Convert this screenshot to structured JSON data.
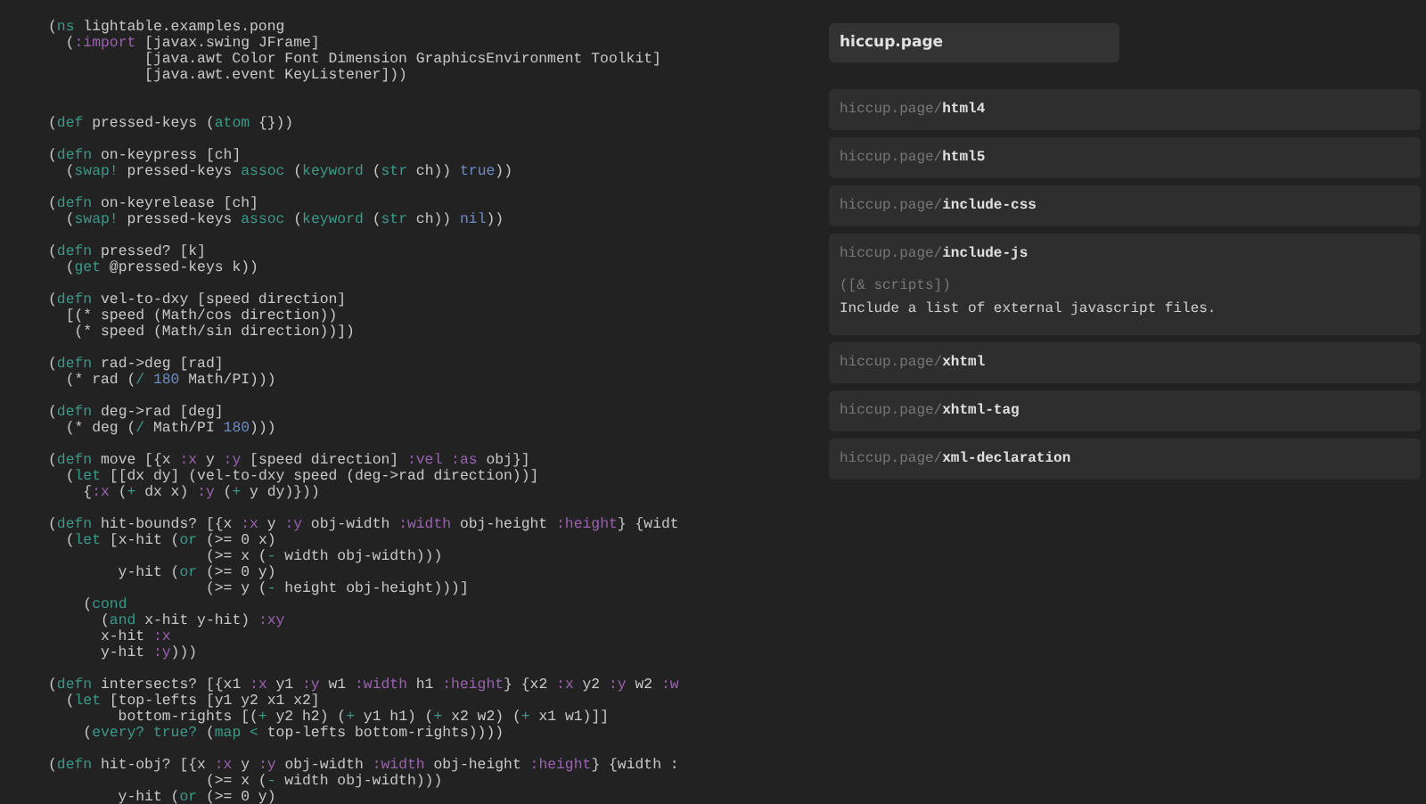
{
  "editor": {
    "lines": [
      {
        "kind": "code",
        "tokens": [
          {
            "kind": "text",
            "text": "("
          },
          {
            "kind": "core",
            "text": "ns"
          },
          {
            "kind": "text",
            "text": " lightable.examples.pong"
          }
        ]
      },
      {
        "kind": "code",
        "tokens": [
          {
            "kind": "text",
            "text": "  ("
          },
          {
            "kind": "keyword",
            "text": ":import"
          },
          {
            "kind": "text",
            "text": " [javax.swing JFrame]"
          }
        ]
      },
      {
        "kind": "code",
        "tokens": [
          {
            "kind": "text",
            "text": "           [java.awt Color Font Dimension GraphicsEnvironment Toolkit]"
          }
        ]
      },
      {
        "kind": "code",
        "tokens": [
          {
            "kind": "text",
            "text": "           [java.awt.event KeyListener]))"
          }
        ]
      },
      {
        "kind": "blank"
      },
      {
        "kind": "blank"
      },
      {
        "kind": "code",
        "tokens": [
          {
            "kind": "text",
            "text": "("
          },
          {
            "kind": "core",
            "text": "def"
          },
          {
            "kind": "text",
            "text": " pressed-keys ("
          },
          {
            "kind": "core",
            "text": "atom"
          },
          {
            "kind": "text",
            "text": " {}))"
          }
        ]
      },
      {
        "kind": "blank"
      },
      {
        "kind": "code",
        "tokens": [
          {
            "kind": "text",
            "text": "("
          },
          {
            "kind": "core",
            "text": "defn"
          },
          {
            "kind": "text",
            "text": " on-keypress [ch]"
          }
        ]
      },
      {
        "kind": "code",
        "tokens": [
          {
            "kind": "text",
            "text": "  ("
          },
          {
            "kind": "core",
            "text": "swap!"
          },
          {
            "kind": "text",
            "text": " pressed-keys "
          },
          {
            "kind": "core",
            "text": "assoc"
          },
          {
            "kind": "text",
            "text": " ("
          },
          {
            "kind": "core",
            "text": "keyword"
          },
          {
            "kind": "text",
            "text": " ("
          },
          {
            "kind": "core",
            "text": "str"
          },
          {
            "kind": "text",
            "text": " ch)) "
          },
          {
            "kind": "literal",
            "text": "true"
          },
          {
            "kind": "text",
            "text": "))"
          }
        ]
      },
      {
        "kind": "blank"
      },
      {
        "kind": "code",
        "tokens": [
          {
            "kind": "text",
            "text": "("
          },
          {
            "kind": "core",
            "text": "defn"
          },
          {
            "kind": "text",
            "text": " on-keyrelease [ch]"
          }
        ]
      },
      {
        "kind": "code",
        "tokens": [
          {
            "kind": "text",
            "text": "  ("
          },
          {
            "kind": "core",
            "text": "swap!"
          },
          {
            "kind": "text",
            "text": " pressed-keys "
          },
          {
            "kind": "core",
            "text": "assoc"
          },
          {
            "kind": "text",
            "text": " ("
          },
          {
            "kind": "core",
            "text": "keyword"
          },
          {
            "kind": "text",
            "text": " ("
          },
          {
            "kind": "core",
            "text": "str"
          },
          {
            "kind": "text",
            "text": " ch)) "
          },
          {
            "kind": "literal",
            "text": "nil"
          },
          {
            "kind": "text",
            "text": "))"
          }
        ]
      },
      {
        "kind": "blank"
      },
      {
        "kind": "code",
        "tokens": [
          {
            "kind": "text",
            "text": "("
          },
          {
            "kind": "core",
            "text": "defn"
          },
          {
            "kind": "text",
            "text": " pressed? [k]"
          }
        ]
      },
      {
        "kind": "code",
        "tokens": [
          {
            "kind": "text",
            "text": "  ("
          },
          {
            "kind": "core",
            "text": "get"
          },
          {
            "kind": "text",
            "text": " @pressed-keys k))"
          }
        ]
      },
      {
        "kind": "blank"
      },
      {
        "kind": "code",
        "tokens": [
          {
            "kind": "text",
            "text": "("
          },
          {
            "kind": "core",
            "text": "defn"
          },
          {
            "kind": "text",
            "text": " vel-to-dxy [speed direction]"
          }
        ]
      },
      {
        "kind": "code",
        "tokens": [
          {
            "kind": "text",
            "text": "  [(* speed (Math/cos direction))"
          }
        ]
      },
      {
        "kind": "code",
        "tokens": [
          {
            "kind": "text",
            "text": "   (* speed (Math/sin direction))])"
          }
        ]
      },
      {
        "kind": "blank"
      },
      {
        "kind": "code",
        "tokens": [
          {
            "kind": "text",
            "text": "("
          },
          {
            "kind": "core",
            "text": "defn"
          },
          {
            "kind": "text",
            "text": " rad->deg [rad]"
          }
        ]
      },
      {
        "kind": "code",
        "tokens": [
          {
            "kind": "text",
            "text": "  (* rad ("
          },
          {
            "kind": "core",
            "text": "/"
          },
          {
            "kind": "literal",
            "text": " 180"
          },
          {
            "kind": "text",
            "text": " Math/PI)))"
          }
        ]
      },
      {
        "kind": "blank"
      },
      {
        "kind": "code",
        "tokens": [
          {
            "kind": "text",
            "text": "("
          },
          {
            "kind": "core",
            "text": "defn"
          },
          {
            "kind": "text",
            "text": " deg->rad [deg]"
          }
        ]
      },
      {
        "kind": "code",
        "tokens": [
          {
            "kind": "text",
            "text": "  (* deg ("
          },
          {
            "kind": "core",
            "text": "/"
          },
          {
            "kind": "text",
            "text": " Math/PI "
          },
          {
            "kind": "literal",
            "text": "180"
          },
          {
            "kind": "text",
            "text": ")))"
          }
        ]
      },
      {
        "kind": "blank"
      },
      {
        "kind": "code",
        "tokens": [
          {
            "kind": "text",
            "text": "("
          },
          {
            "kind": "core",
            "text": "defn"
          },
          {
            "kind": "text",
            "text": " move [{x "
          },
          {
            "kind": "keyword",
            "text": ":x"
          },
          {
            "kind": "text",
            "text": " y "
          },
          {
            "kind": "keyword",
            "text": ":y"
          },
          {
            "kind": "text",
            "text": " [speed direction] "
          },
          {
            "kind": "keyword",
            "text": ":vel :as"
          },
          {
            "kind": "text",
            "text": " obj}]"
          }
        ]
      },
      {
        "kind": "code",
        "tokens": [
          {
            "kind": "text",
            "text": "  ("
          },
          {
            "kind": "core",
            "text": "let"
          },
          {
            "kind": "text",
            "text": " [[dx dy] (vel-to-dxy speed (deg->rad direction))]"
          }
        ]
      },
      {
        "kind": "code",
        "tokens": [
          {
            "kind": "text",
            "text": "    {"
          },
          {
            "kind": "keyword",
            "text": ":x"
          },
          {
            "kind": "text",
            "text": " ("
          },
          {
            "kind": "core",
            "text": "+"
          },
          {
            "kind": "text",
            "text": " dx x) "
          },
          {
            "kind": "keyword",
            "text": ":y"
          },
          {
            "kind": "text",
            "text": " ("
          },
          {
            "kind": "core",
            "text": "+"
          },
          {
            "kind": "text",
            "text": " y dy)}))"
          }
        ]
      },
      {
        "kind": "blank"
      },
      {
        "kind": "code",
        "tokens": [
          {
            "kind": "text",
            "text": "("
          },
          {
            "kind": "core",
            "text": "defn"
          },
          {
            "kind": "text",
            "text": " hit-bounds? [{x "
          },
          {
            "kind": "keyword",
            "text": ":x"
          },
          {
            "kind": "text",
            "text": " y "
          },
          {
            "kind": "keyword",
            "text": ":y"
          },
          {
            "kind": "text",
            "text": " obj-width "
          },
          {
            "kind": "keyword",
            "text": ":width"
          },
          {
            "kind": "text",
            "text": " obj-height "
          },
          {
            "kind": "keyword",
            "text": ":height"
          },
          {
            "kind": "text",
            "text": "} {widt"
          }
        ]
      },
      {
        "kind": "code",
        "tokens": [
          {
            "kind": "text",
            "text": "  ("
          },
          {
            "kind": "core",
            "text": "let"
          },
          {
            "kind": "text",
            "text": " [x-hit ("
          },
          {
            "kind": "core",
            "text": "or"
          },
          {
            "kind": "text",
            "text": " (>= 0 x)"
          }
        ]
      },
      {
        "kind": "code",
        "tokens": [
          {
            "kind": "text",
            "text": "                  (>= x ("
          },
          {
            "kind": "core",
            "text": "-"
          },
          {
            "kind": "text",
            "text": " width obj-width)))"
          }
        ]
      },
      {
        "kind": "code",
        "tokens": [
          {
            "kind": "text",
            "text": "        y-hit ("
          },
          {
            "kind": "core",
            "text": "or"
          },
          {
            "kind": "text",
            "text": " (>= 0 y)"
          }
        ]
      },
      {
        "kind": "code",
        "tokens": [
          {
            "kind": "text",
            "text": "                  (>= y ("
          },
          {
            "kind": "core",
            "text": "-"
          },
          {
            "kind": "text",
            "text": " height obj-height)))]"
          }
        ]
      },
      {
        "kind": "code",
        "tokens": [
          {
            "kind": "text",
            "text": "    ("
          },
          {
            "kind": "core",
            "text": "cond"
          }
        ]
      },
      {
        "kind": "code",
        "tokens": [
          {
            "kind": "text",
            "text": "      ("
          },
          {
            "kind": "core",
            "text": "and"
          },
          {
            "kind": "text",
            "text": " x-hit y-hit) "
          },
          {
            "kind": "keyword",
            "text": ":xy"
          }
        ]
      },
      {
        "kind": "code",
        "tokens": [
          {
            "kind": "text",
            "text": "      x-hit "
          },
          {
            "kind": "keyword",
            "text": ":x"
          }
        ]
      },
      {
        "kind": "code",
        "tokens": [
          {
            "kind": "text",
            "text": "      y-hit "
          },
          {
            "kind": "keyword",
            "text": ":y"
          },
          {
            "kind": "text",
            "text": ")))"
          }
        ]
      },
      {
        "kind": "blank"
      },
      {
        "kind": "code",
        "tokens": [
          {
            "kind": "text",
            "text": "("
          },
          {
            "kind": "core",
            "text": "defn"
          },
          {
            "kind": "text",
            "text": " intersects? [{x1 "
          },
          {
            "kind": "keyword",
            "text": ":x"
          },
          {
            "kind": "text",
            "text": " y1 "
          },
          {
            "kind": "keyword",
            "text": ":y"
          },
          {
            "kind": "text",
            "text": " w1 "
          },
          {
            "kind": "keyword",
            "text": ":width"
          },
          {
            "kind": "text",
            "text": " h1 "
          },
          {
            "kind": "keyword",
            "text": ":height"
          },
          {
            "kind": "text",
            "text": "} {x2 "
          },
          {
            "kind": "keyword",
            "text": ":x"
          },
          {
            "kind": "text",
            "text": " y2 "
          },
          {
            "kind": "keyword",
            "text": ":y"
          },
          {
            "kind": "text",
            "text": " w2 "
          },
          {
            "kind": "keyword",
            "text": ":w"
          }
        ]
      },
      {
        "kind": "code",
        "tokens": [
          {
            "kind": "text",
            "text": "  ("
          },
          {
            "kind": "core",
            "text": "let"
          },
          {
            "kind": "text",
            "text": " [top-lefts [y1 y2 x1 x2]"
          }
        ]
      },
      {
        "kind": "code",
        "tokens": [
          {
            "kind": "text",
            "text": "        bottom-rights [("
          },
          {
            "kind": "core",
            "text": "+"
          },
          {
            "kind": "text",
            "text": " y2 h2) ("
          },
          {
            "kind": "core",
            "text": "+"
          },
          {
            "kind": "text",
            "text": " y1 h1) ("
          },
          {
            "kind": "core",
            "text": "+"
          },
          {
            "kind": "text",
            "text": " x2 w2) ("
          },
          {
            "kind": "core",
            "text": "+"
          },
          {
            "kind": "text",
            "text": " x1 w1)]]"
          }
        ]
      },
      {
        "kind": "code",
        "tokens": [
          {
            "kind": "text",
            "text": "    ("
          },
          {
            "kind": "core",
            "text": "every? true?"
          },
          {
            "kind": "text",
            "text": " ("
          },
          {
            "kind": "core",
            "text": "map <"
          },
          {
            "kind": "text",
            "text": " top-lefts bottom-rights))))"
          }
        ]
      },
      {
        "kind": "blank"
      },
      {
        "kind": "code",
        "tokens": [
          {
            "kind": "text",
            "text": "("
          },
          {
            "kind": "core",
            "text": "defn"
          },
          {
            "kind": "text",
            "text": " hit-obj? [{x "
          },
          {
            "kind": "keyword",
            "text": ":x"
          },
          {
            "kind": "text",
            "text": " y "
          },
          {
            "kind": "keyword",
            "text": ":y"
          },
          {
            "kind": "text",
            "text": " obj-width "
          },
          {
            "kind": "keyword",
            "text": ":width"
          },
          {
            "kind": "text",
            "text": " obj-height "
          },
          {
            "kind": "keyword",
            "text": ":height"
          },
          {
            "kind": "text",
            "text": "} {width :"
          }
        ]
      },
      {
        "kind": "code",
        "tokens": [
          {
            "kind": "text",
            "text": "                  (>= x ("
          },
          {
            "kind": "core",
            "text": "-"
          },
          {
            "kind": "text",
            "text": " width obj-width)))"
          }
        ]
      },
      {
        "kind": "code",
        "tokens": [
          {
            "kind": "text",
            "text": "        y-hit ("
          },
          {
            "kind": "core",
            "text": "or"
          },
          {
            "kind": "text",
            "text": " (>= 0 y)"
          }
        ]
      }
    ]
  },
  "doc_search": {
    "query": "hiccup.page",
    "results": [
      {
        "namespace": "hiccup.page/",
        "name": "html4"
      },
      {
        "namespace": "hiccup.page/",
        "name": "html5"
      },
      {
        "namespace": "hiccup.page/",
        "name": "include-css"
      },
      {
        "namespace": "hiccup.page/",
        "name": "include-js",
        "signature": "([& scripts])",
        "doc": "Include a list of external javascript files."
      },
      {
        "namespace": "hiccup.page/",
        "name": "xhtml"
      },
      {
        "namespace": "hiccup.page/",
        "name": "xhtml-tag"
      },
      {
        "namespace": "hiccup.page/",
        "name": "xml-declaration"
      }
    ]
  }
}
